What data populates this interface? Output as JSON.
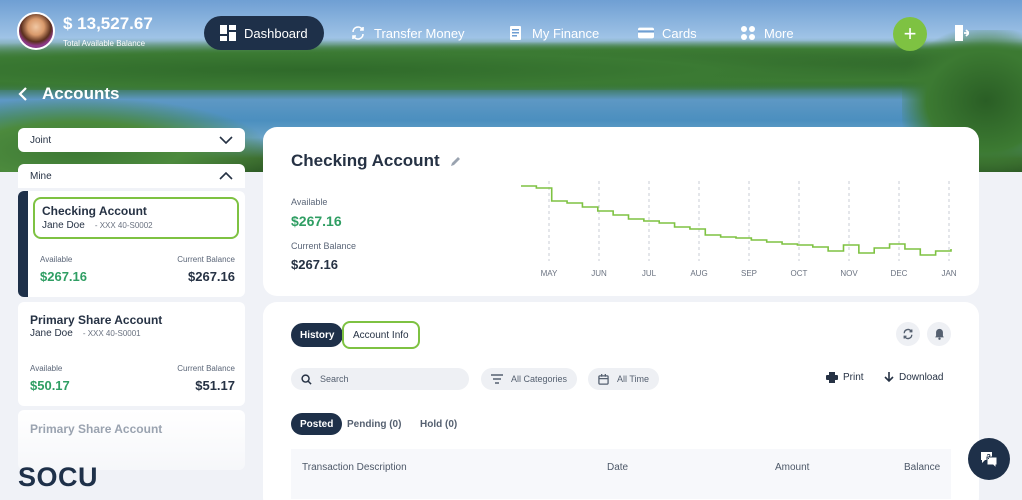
{
  "header": {
    "total_balance": "$ 13,527.67",
    "total_balance_label": "Total Available Balance",
    "nav": [
      {
        "label": "Dashboard",
        "icon": "dashboard-icon"
      },
      {
        "label": "Transfer Money",
        "icon": "transfer-icon"
      },
      {
        "label": "My Finance",
        "icon": "finance-icon"
      },
      {
        "label": "Cards",
        "icon": "card-icon"
      },
      {
        "label": "More",
        "icon": "more-icon"
      }
    ],
    "add_label": "+"
  },
  "page": {
    "title": "Accounts"
  },
  "sidebar": {
    "groups": [
      {
        "label": "Joint",
        "state": "collapsed"
      },
      {
        "label": "Mine",
        "state": "expanded"
      }
    ],
    "accounts": [
      {
        "name": "Checking Account",
        "holder": "Jane Doe",
        "number": "- XXX 40-S0002",
        "available_label": "Available",
        "available": "$267.16",
        "current_label": "Current Balance",
        "current": "$267.16"
      },
      {
        "name": "Primary Share Account",
        "holder": "Jane Doe",
        "number": "- XXX 40-S0001",
        "available_label": "Available",
        "available": "$50.17",
        "current_label": "Current Balance",
        "current": "$51.17"
      },
      {
        "name": "Primary Share Account"
      }
    ]
  },
  "brand": {
    "logo": "SOCU"
  },
  "summary": {
    "title": "Checking Account",
    "available_label": "Available",
    "available": "$267.16",
    "current_label": "Current Balance",
    "current": "$267.16"
  },
  "chart_data": {
    "type": "line",
    "x": [
      "MAY",
      "JUN",
      "JUL",
      "AUG",
      "SEP",
      "OCT",
      "NOV",
      "DEC",
      "JAN"
    ],
    "series": [
      {
        "values": [
          255,
          253,
          240,
          238,
          234,
          230,
          226,
          222,
          220,
          218,
          214,
          212,
          206,
          204,
          203,
          201,
          199,
          197,
          196,
          194,
          190,
          196,
          188,
          193,
          197,
          192,
          186,
          190,
          192
        ]
      }
    ],
    "grid": "vertical-dashed",
    "color": "#7ec242"
  },
  "activity": {
    "tabs": [
      {
        "label": "History",
        "active": true
      },
      {
        "label": "Account Info",
        "active": false
      }
    ],
    "search_placeholder": "Search",
    "category_filter": "All Categories",
    "time_filter": "All Time",
    "print_label": "Print",
    "download_label": "Download",
    "status_tabs": [
      {
        "label": "Posted",
        "active": true
      },
      {
        "label": "Pending (0)"
      },
      {
        "label": "Hold (0)"
      }
    ],
    "columns": [
      "Transaction Description",
      "Date",
      "Amount",
      "Balance"
    ]
  },
  "colors": {
    "navy": "#1e3049",
    "green": "#7ec242",
    "money_green": "#2f9e63"
  }
}
